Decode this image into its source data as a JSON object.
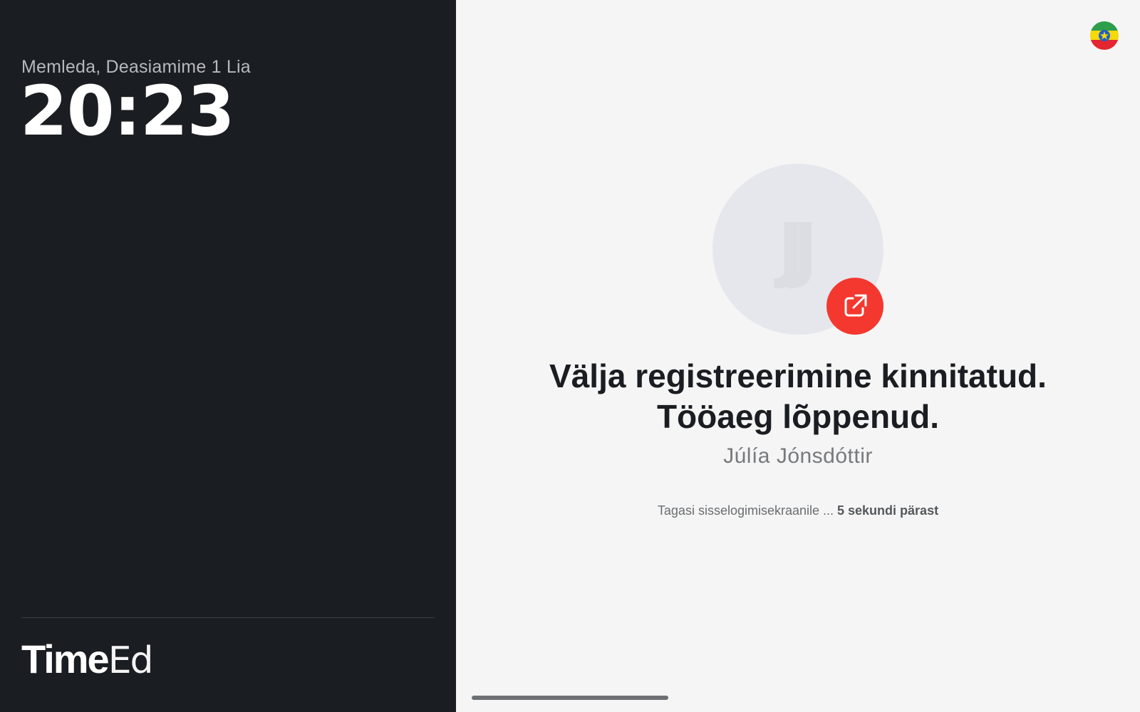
{
  "kiosk": {
    "date_label": "Memleda, Deasiamime 1 Lia",
    "time": "20:23",
    "logo_bold": "Time",
    "logo_thin": "Ed"
  },
  "confirmation": {
    "headline_line1": "Välja registreerimine kinnitatud.",
    "headline_line2": "Tööaeg lõppenud.",
    "employee_name": "Júlía Jónsdóttir",
    "avatar_initials": "JJ",
    "countdown_prefix": "Tagasi sisselogimisekraanile ... ",
    "countdown_value": "5 sekundi pärast"
  },
  "icons": {
    "status_badge": "exit-icon",
    "language": "flag-icon"
  },
  "colors": {
    "left_panel_bg": "#1a1d21",
    "right_panel_bg": "#f5f5f5",
    "accent_red": "#f4382f",
    "avatar_bg": "#e6e7ec"
  }
}
